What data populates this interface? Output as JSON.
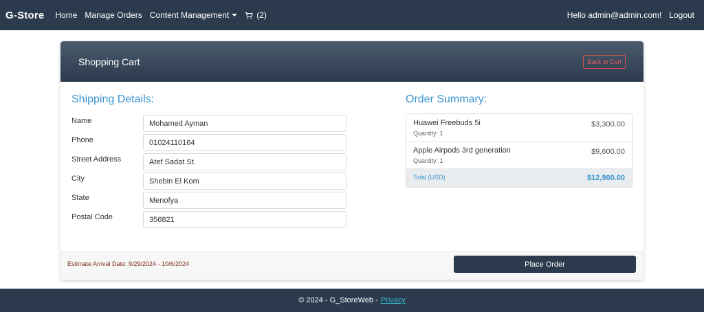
{
  "nav": {
    "brand": "G-Store",
    "links": [
      "Home",
      "Manage Orders",
      "Content Management"
    ],
    "cart_count": "(2)",
    "greeting": "Hello admin@admin.com!",
    "logout": "Logout"
  },
  "card": {
    "title": "Shopping Cart",
    "back_button": "Back to Cart"
  },
  "shipping": {
    "title": "Shipping Details:",
    "fields": [
      {
        "label": "Name",
        "value": "Mohamed Ayman"
      },
      {
        "label": "Phone",
        "value": "01024110164"
      },
      {
        "label": "Street Address",
        "value": "Atef Sadat St."
      },
      {
        "label": "City",
        "value": "Shebin El Kom"
      },
      {
        "label": "State",
        "value": "Menofya"
      },
      {
        "label": "Postal Code",
        "value": "356821"
      }
    ]
  },
  "summary": {
    "title": "Order Summary:",
    "items": [
      {
        "name": "Huawei Freebuds 5i",
        "quantity": "Quantity: 1",
        "price": "$3,300.00"
      },
      {
        "name": "Apple Airpods 3rd generation",
        "quantity": "Quantity: 1",
        "price": "$9,600.00"
      }
    ],
    "total_label": "Total (USD)",
    "total_value": "$12,900.00"
  },
  "footer_bar": {
    "arrival": "Estimate Arrival Date: 9/29/2024 - 10/6/2024",
    "place_order": "Place Order"
  },
  "footer": {
    "copyright": "© 2024 - G_StoreWeb -",
    "privacy": "Privacy"
  },
  "colors": {
    "navbar": "#2b3a4d",
    "accent": "#3a94cf",
    "danger": "#d9534f"
  }
}
